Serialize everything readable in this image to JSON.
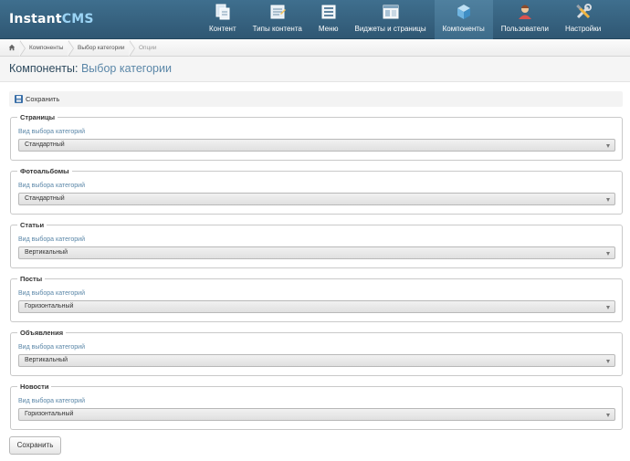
{
  "logo": {
    "part1": "Instant",
    "part2": "CMS"
  },
  "nav": {
    "items": [
      {
        "label": "Контент",
        "icon": "content-icon",
        "active": false
      },
      {
        "label": "Типы контента",
        "icon": "content-types-icon",
        "active": false
      },
      {
        "label": "Меню",
        "icon": "menu-icon",
        "active": false
      },
      {
        "label": "Виджеты и страницы",
        "icon": "widgets-icon",
        "active": false
      },
      {
        "label": "Компоненты",
        "icon": "components-cube-icon",
        "active": true
      },
      {
        "label": "Пользователи",
        "icon": "users-icon",
        "active": false
      },
      {
        "label": "Настройки",
        "icon": "settings-tools-icon",
        "active": false
      }
    ]
  },
  "breadcrumb": {
    "home_icon": "home-icon",
    "items": [
      "Компоненты",
      "Выбор категории",
      "Опции"
    ]
  },
  "page": {
    "title_prefix": "Компоненты:",
    "title_suffix": " Выбор категории"
  },
  "toolbar": {
    "save_label": "Сохранить"
  },
  "sections": [
    {
      "legend": "Страницы",
      "field_label": "Вид выбора категорий",
      "value": "Стандартный"
    },
    {
      "legend": "Фотоальбомы",
      "field_label": "Вид выбора категорий",
      "value": "Стандартный"
    },
    {
      "legend": "Статьи",
      "field_label": "Вид выбора категорий",
      "value": "Вертикальный"
    },
    {
      "legend": "Посты",
      "field_label": "Вид выбора категорий",
      "value": "Горизонтальный"
    },
    {
      "legend": "Объявления",
      "field_label": "Вид выбора категорий",
      "value": "Вертикальный"
    },
    {
      "legend": "Новости",
      "field_label": "Вид выбора категорий",
      "value": "Горизонтальный"
    }
  ],
  "footer": {
    "save_label": "Сохранить"
  },
  "colors": {
    "header": "#2f5773",
    "accent": "#5b87a8",
    "label": "#5b87a8"
  }
}
